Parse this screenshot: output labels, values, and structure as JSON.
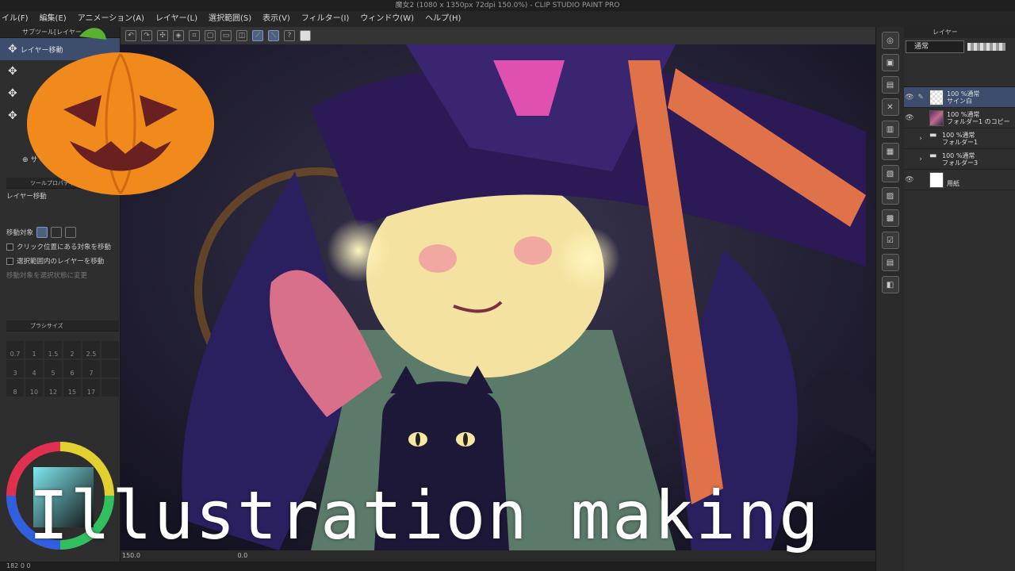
{
  "window": {
    "title": "魔女2 (1080 x 1350px 72dpi 150.0%)  - CLIP STUDIO PAINT PRO"
  },
  "menu": [
    "イル(F)",
    "編集(E)",
    "アニメーション(A)",
    "レイヤー(L)",
    "選択範囲(S)",
    "表示(V)",
    "フィルター(I)",
    "ウィンドウ(W)",
    "ヘルプ(H)"
  ],
  "left_panel": {
    "subtool_header": "サブツール[レイヤー",
    "subtool_items": [
      "レイヤー移動",
      "",
      "",
      ""
    ],
    "subtool_add": "サ",
    "toolprop_header": "ツールプロパティ[レイヤー移動]",
    "toolprop_name": "レイヤー移動",
    "move_target_label": "移動対象",
    "options": [
      "クリック位置にある対象を移動",
      "選択範囲内のレイヤーを移動",
      "移動対象を選択状態に変更"
    ],
    "brushsize_header": "ブラシサイズ",
    "brush_sizes": [
      "0.7",
      "1",
      "1.5",
      "2",
      "2.5",
      "3",
      "4",
      "5",
      "6",
      "7",
      "8",
      "10",
      "12",
      "15",
      "17"
    ]
  },
  "status": {
    "zoom": "150.0",
    "rotation": "0.0",
    "bottom": "182  0  0"
  },
  "layers": {
    "header": "レイヤー",
    "blend_mode": "通常",
    "items": [
      {
        "mode": "100 %通常",
        "name": "サイン白",
        "thumb": "checker",
        "selected": true
      },
      {
        "mode": "100 %通常",
        "name": "フォルダー1 のコピー",
        "thumb": "art",
        "selected": false
      },
      {
        "mode": "100 %通常",
        "name": "フォルダー1",
        "thumb": "folder",
        "selected": false
      },
      {
        "mode": "100 %通常",
        "name": "フォルダー3",
        "thumb": "folder",
        "selected": false
      },
      {
        "mode": "",
        "name": "用紙",
        "thumb": "white",
        "selected": false
      }
    ]
  },
  "overlay": {
    "title": "Illustration making"
  },
  "colors": {
    "accent": "#3c4d6e",
    "pumpkin": "#f08a1c",
    "witch_hat": "#2b1a55"
  }
}
